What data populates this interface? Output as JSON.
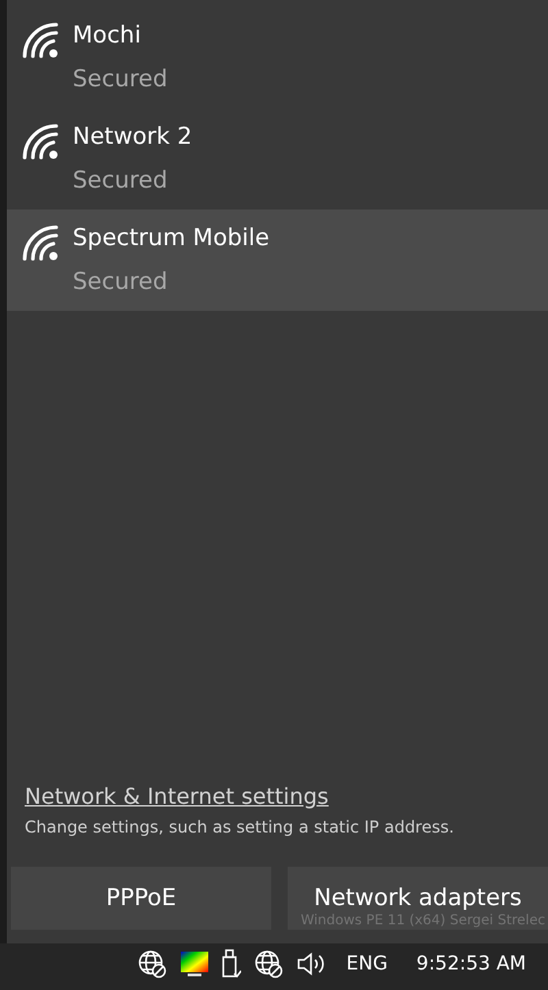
{
  "networks": [
    {
      "name": "Mochi",
      "status": "Secured",
      "selected": false
    },
    {
      "name": "Network 2",
      "status": "Secured",
      "selected": false
    },
    {
      "name": "Spectrum Mobile",
      "status": "Secured",
      "selected": true
    }
  ],
  "settings": {
    "link": "Network & Internet settings",
    "description": "Change settings, such as setting a static IP address."
  },
  "quick_actions": [
    "PPPoE",
    "Network adapters"
  ],
  "desktop_watermark": "Windows PE 11 (x64) Sergei Strelec",
  "taskbar": {
    "language": "ENG",
    "time": "9:52:53 AM"
  }
}
